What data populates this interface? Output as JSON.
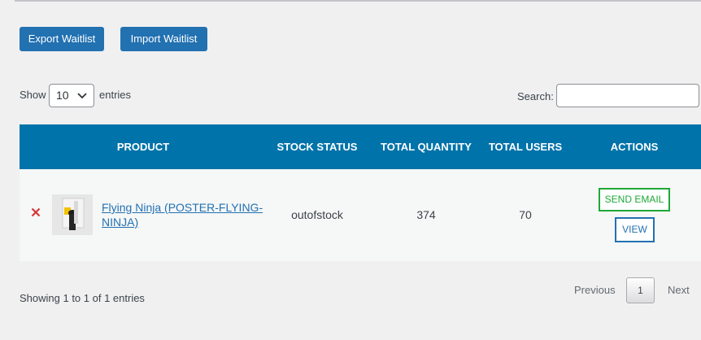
{
  "toolbar": {
    "export_label": "Export Waitlist",
    "import_label": "Import Waitlist"
  },
  "length": {
    "show_label": "Show",
    "selected": "10",
    "entries_label": "entries"
  },
  "search": {
    "label": "Search:",
    "value": ""
  },
  "table": {
    "headers": [
      "PRODUCT",
      "STOCK STATUS",
      "TOTAL QUANTITY",
      "TOTAL USERS",
      "ACTIONS"
    ],
    "rows": [
      {
        "product_name": "Flying Ninja (POSTER-FLYING-NINJA)",
        "stock_status": "outofstock",
        "total_quantity": "374",
        "total_users": "70",
        "send_email_label": "SEND EMAIL",
        "view_label": "VIEW"
      }
    ]
  },
  "footer": {
    "info": "Showing 1 to 1 of 1 entries",
    "previous": "Previous",
    "current_page": "1",
    "next": "Next"
  },
  "colors": {
    "header": "#0073aa",
    "button": "#2271b1",
    "send_email": "#1ea836",
    "remove": "#d63638"
  }
}
